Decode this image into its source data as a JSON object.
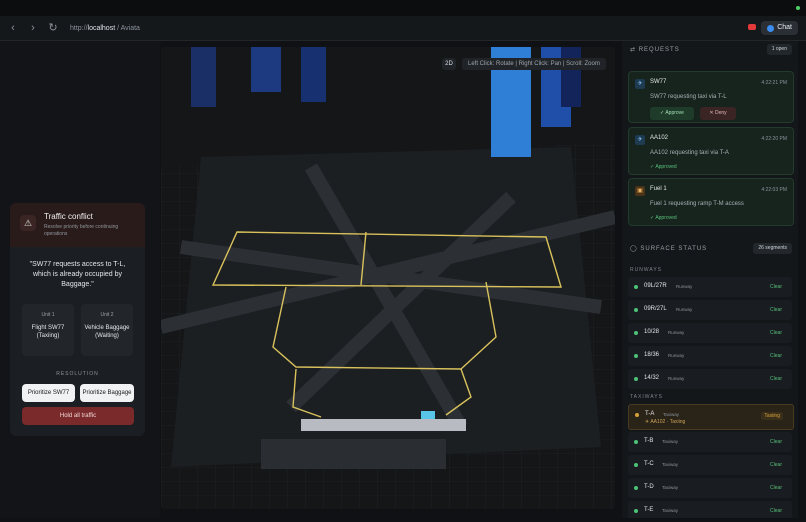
{
  "browser": {
    "url_prefix": "http://",
    "url_host": "localhost",
    "url_path": " / Aviata",
    "chat_label": "Chat"
  },
  "colors": {
    "accent_green": "#4cc275",
    "taxiing": "#d8a23a",
    "deny_red": "#7a2a2a",
    "runway_line": "#d9c25c"
  },
  "conflict": {
    "title": "Traffic conflict",
    "subtitle": "Resolve priority before continuing operations",
    "quote": "\"SW77 requests access to T-L, which is already occupied by Baggage.\"",
    "units": [
      {
        "label": "Unit 1",
        "value_line1": "Flight SW77",
        "value_line2": "(Taxiing)"
      },
      {
        "label": "Unit 2",
        "value_line1": "Vehicle Baggage",
        "value_line2": "(Waiting)"
      }
    ],
    "resolution_label": "RESOLUTION",
    "btn_sw77": "Prioritize SW77",
    "btn_baggage": "Prioritize Baggage",
    "btn_hold": "Hold all traffic"
  },
  "map": {
    "mode": "2D",
    "hint": "Left Click: Rotate | Right Click: Pan | Scroll: Zoom"
  },
  "requests": {
    "title": "REQUESTS",
    "open_badge": "1 open",
    "items": [
      {
        "name": "SW77",
        "time": "4:22:21 PM",
        "message": "SW77 requesting taxi via T-L",
        "approve": "Approve",
        "deny": "Deny",
        "icon": "plane-icon"
      },
      {
        "name": "AA102",
        "time": "4:22:20 PM",
        "message": "AA102 requesting taxi via T-A",
        "status": "Approved",
        "icon": "plane-icon"
      },
      {
        "name": "Fuel 1",
        "time": "4:22:03 PM",
        "message": "Fuel 1 requesting ramp T-M access",
        "status": "Approved",
        "icon": "truck-icon"
      }
    ]
  },
  "surface": {
    "title": "SURFACE STATUS",
    "count_badge": "26 segments",
    "runways_label": "RUNWAYS",
    "runways": [
      {
        "name": "09L/27R",
        "type": "Runway",
        "status": "Clear"
      },
      {
        "name": "09R/27L",
        "type": "Runway",
        "status": "Clear"
      },
      {
        "name": "10/28",
        "type": "Runway",
        "status": "Clear"
      },
      {
        "name": "18/36",
        "type": "Runway",
        "status": "Clear"
      },
      {
        "name": "14/32",
        "type": "Runway",
        "status": "Clear"
      }
    ],
    "taxiways_label": "TAXIWAYS",
    "taxiways": [
      {
        "name": "T-A",
        "type": "Taxiway",
        "status": "Taxiing",
        "sub": "AA102",
        "sub_status": "Taxiing"
      },
      {
        "name": "T-B",
        "type": "Taxiway",
        "status": "Clear"
      },
      {
        "name": "T-C",
        "type": "Taxiway",
        "status": "Clear"
      },
      {
        "name": "T-D",
        "type": "Taxiway",
        "status": "Clear"
      },
      {
        "name": "T-E",
        "type": "Taxiway",
        "status": "Clear"
      }
    ]
  }
}
